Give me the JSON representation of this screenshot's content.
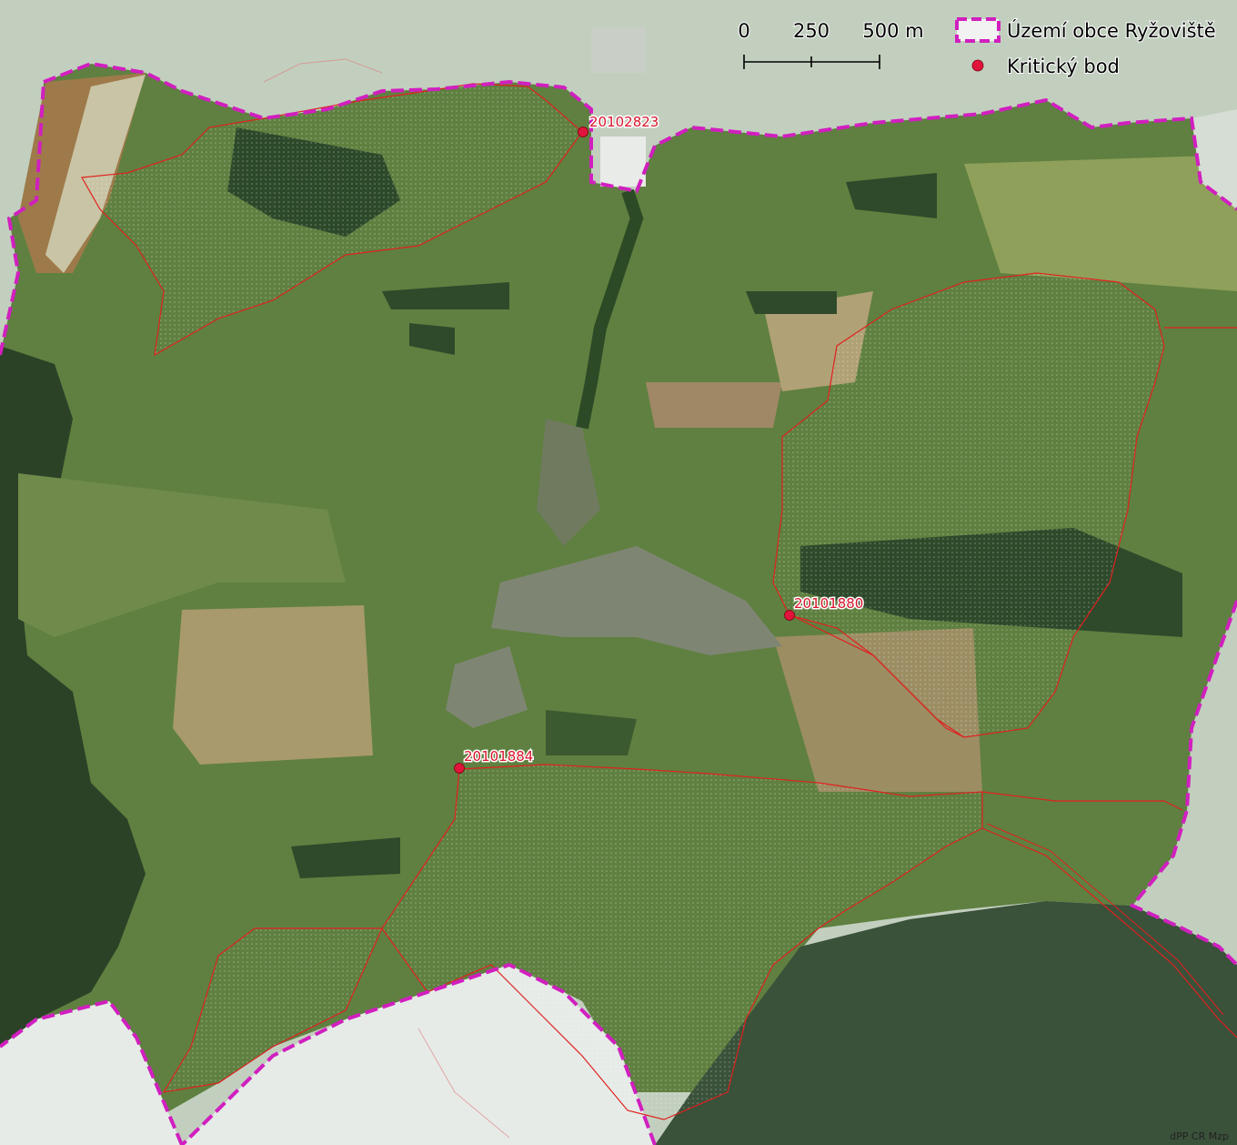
{
  "scale_bar": {
    "tick_labels": [
      "0",
      "250",
      "500 m"
    ]
  },
  "legend": {
    "items": [
      {
        "label": "Území obce Ryžoviště",
        "symbol": "dashed-boundary",
        "color": "#d11fbf"
      },
      {
        "label": "Kritický bod",
        "symbol": "point",
        "color": "#e0143c"
      }
    ]
  },
  "critical_points": [
    {
      "id": "20102823"
    },
    {
      "id": "20101880"
    },
    {
      "id": "20101884"
    }
  ],
  "credit": "dPP CR Mzp",
  "colors": {
    "boundary": "#d11fbf",
    "catchment": "#e0211f",
    "point": "#e0143c",
    "field_green": "#5a7c3c",
    "forest": "#2a4228",
    "hay": "#a89a6c",
    "outside": "#dfe4e0"
  }
}
